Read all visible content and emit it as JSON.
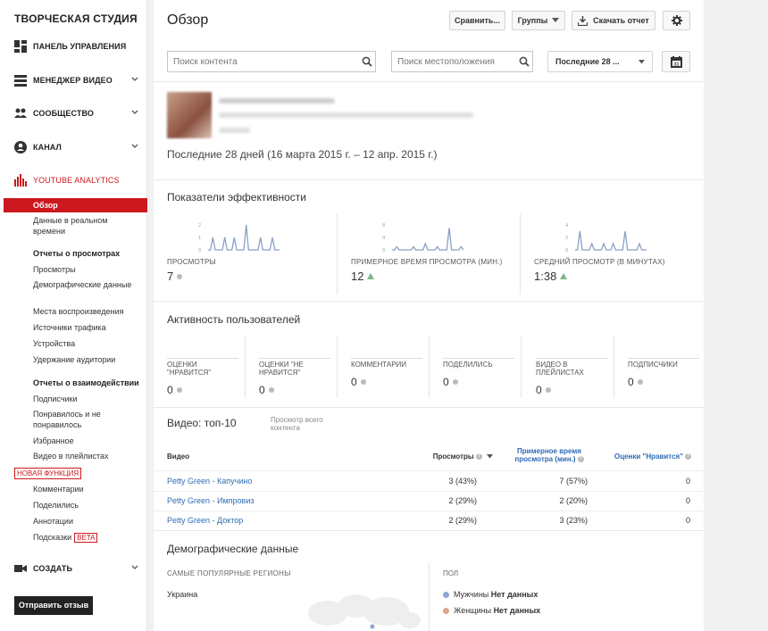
{
  "sidebar": {
    "title": "ТВОРЧЕСКАЯ СТУДИЯ",
    "items": [
      {
        "label": "ПАНЕЛЬ УПРАВЛЕНИЯ"
      },
      {
        "label": "МЕНЕДЖЕР ВИДЕО"
      },
      {
        "label": "СООБЩЕСТВО"
      },
      {
        "label": "КАНАЛ"
      },
      {
        "label": "YOUTUBE ANALYTICS"
      },
      {
        "label": "СОЗДАТЬ"
      }
    ],
    "analytics": {
      "overview": "Обзор",
      "realtime": "Данные в реальном времени",
      "views_reports_header": "Отчеты о просмотрах",
      "views": "Просмотры",
      "demographics": "Демографические данные",
      "playback_locations": "Места воспроизведения",
      "traffic_sources": "Источники трафика",
      "devices": "Устройства",
      "retention": "Удержание аудитории",
      "interaction_header": "Отчеты о взаимодействии",
      "subscribers": "Подписчики",
      "likes_dislikes": "Понравилось и не понравилось",
      "favorites": "Избранное",
      "playlists": "Видео в плейлистах",
      "new_badge": "НОВАЯ ФУНКЦИЯ",
      "comments": "Комментарии",
      "shares": "Поделились",
      "annotations": "Аннотации",
      "cards": "Подсказки",
      "beta": "BETA"
    },
    "feedback_button": "Отправить отзыв"
  },
  "header": {
    "title": "Обзор",
    "compare": "Сравнить...",
    "groups": "Группы",
    "download": "Скачать отчет"
  },
  "filters": {
    "content_search_placeholder": "Поиск контента",
    "location_search_placeholder": "Поиск местоположения",
    "date_range": "Последние 28 ..."
  },
  "channel": {
    "period": "Последние 28 дней (16 марта 2015 г. – 12 апр. 2015 г.)"
  },
  "performance": {
    "title": "Показатели эффективности",
    "metrics": [
      {
        "label": "ПРОСМОТРЫ",
        "value": "7",
        "trend": "neutral",
        "ymax_label": "2",
        "ymid_label": "1",
        "ymin_label": "0",
        "spark": [
          0,
          0,
          1,
          0,
          0,
          0,
          0,
          1,
          0,
          0,
          0,
          1,
          0,
          0,
          0,
          0,
          2,
          0,
          0,
          0,
          0,
          0,
          1,
          0,
          0,
          0,
          0,
          1,
          0,
          0,
          0
        ]
      },
      {
        "label": "ПРИМЕРНОЕ ВРЕМЯ ПРОСМОТРА (МИН.)",
        "value": "12",
        "trend": "up",
        "ymax_label": "8",
        "ymid_label": "4",
        "ymin_label": "0",
        "spark": [
          0,
          0,
          1,
          0,
          0,
          0,
          0,
          0,
          0,
          1,
          0,
          0,
          0,
          0,
          2,
          0,
          0,
          0,
          0,
          1,
          0,
          0,
          0,
          0,
          7,
          0,
          0,
          0,
          0,
          1,
          0
        ]
      },
      {
        "label": "СРЕДНИЙ ПРОСМОТР (В МИНУТАХ)",
        "value": "1:38",
        "trend": "up",
        "ymax_label": "4",
        "ymid_label": "2",
        "ymin_label": "0",
        "spark": [
          0,
          0,
          3,
          0,
          0,
          0,
          0,
          1,
          0,
          0,
          0,
          0,
          1,
          0,
          0,
          0,
          1,
          0,
          0,
          0,
          0,
          3,
          0,
          0,
          0,
          0,
          0,
          1,
          0,
          0,
          0
        ]
      }
    ]
  },
  "activity": {
    "title": "Активность пользователей",
    "items": [
      {
        "label": "ОЦЕНКИ \"НРАВИТСЯ\"",
        "value": "0"
      },
      {
        "label": "ОЦЕНКИ \"НЕ НРАВИТСЯ\"",
        "value": "0"
      },
      {
        "label": "КОММЕНТАРИИ",
        "value": "0"
      },
      {
        "label": "ПОДЕЛИЛИСЬ",
        "value": "0"
      },
      {
        "label": "ВИДЕО В ПЛЕЙЛИСТАХ",
        "value": "0"
      },
      {
        "label": "ПОДПИСЧИКИ",
        "value": "0"
      }
    ]
  },
  "top_videos": {
    "title": "Видео: топ-10",
    "view_all": "Просмотр всего контента",
    "columns": {
      "video": "Видео",
      "views": "Просмотры",
      "watch_time": "Примерное время просмотра (мин.)",
      "likes": "Оценки \"Нравится\""
    },
    "rows": [
      {
        "title": "Petty Green - Капучино",
        "views": "3 (43%)",
        "watch": "7 (57%)",
        "likes": "0"
      },
      {
        "title": "Petty Green - Импровиз",
        "views": "2 (29%)",
        "watch": "2 (20%)",
        "likes": "0"
      },
      {
        "title": "Petty Green - Доктор",
        "views": "2 (29%)",
        "watch": "3 (23%)",
        "likes": "0"
      }
    ]
  },
  "demographics": {
    "title": "Демографические данные",
    "regions_header": "САМЫЕ ПОПУЛЯРНЫЕ РЕГИОНЫ",
    "region": "Украина",
    "gender_header": "ПОЛ",
    "male_label": "Мужчины",
    "male_value": "Нет данных",
    "female_label": "Женщины",
    "female_value": "Нет данных"
  },
  "colors": {
    "accent": "#cc181e",
    "link": "#2d6cb5",
    "spark": "#8aa0c3",
    "male": "#8ea7d6",
    "female": "#e0a58a"
  }
}
